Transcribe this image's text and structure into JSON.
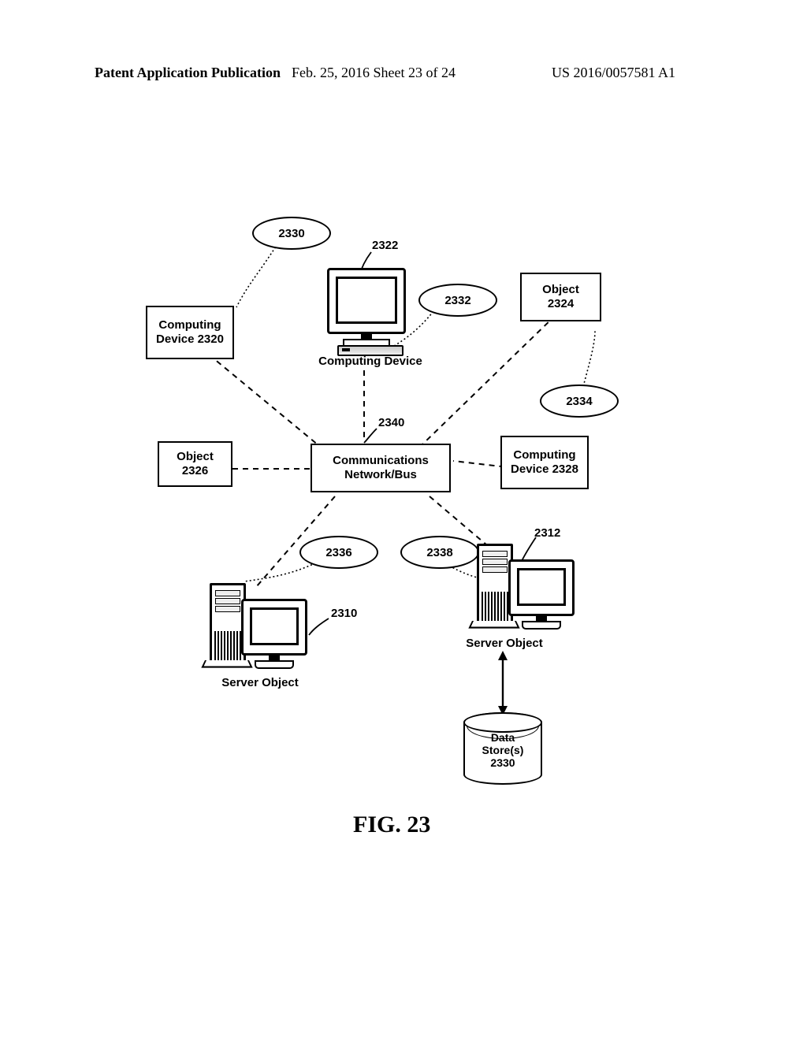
{
  "header": {
    "left": "Patent Application Publication",
    "center": "Feb. 25, 2016  Sheet 23 of 24",
    "right": "US 2016/0057581 A1"
  },
  "figure_label": "FIG. 23",
  "refs": {
    "r2322": "2322",
    "r2340": "2340",
    "r2310": "2310",
    "r2312": "2312"
  },
  "bubbles": {
    "b2330": "2330",
    "b2332": "2332",
    "b2334": "2334",
    "b2336": "2336",
    "b2338": "2338"
  },
  "boxes": {
    "computing_device_2320": "Computing Device 2320",
    "object_2324_l1": "Object",
    "object_2324_l2": "2324",
    "object_2326_l1": "Object",
    "object_2326_l2": "2326",
    "computing_device_2328": "Computing Device 2328",
    "comm_net_l1": "Communications",
    "comm_net_l2": "Network/Bus"
  },
  "labels": {
    "computing_device_below": "Computing Device",
    "server_object_left": "Server Object",
    "server_object_right": "Server Object",
    "data_store_l1": "Data",
    "data_store_l2": "Store(s)",
    "data_store_l3": "2330"
  }
}
